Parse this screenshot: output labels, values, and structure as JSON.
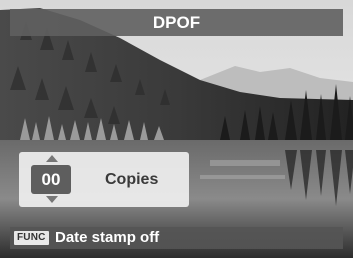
{
  "header": {
    "title": "DPOF"
  },
  "copies_panel": {
    "count": "00",
    "label": "Copies"
  },
  "footer": {
    "func_key": "FUNC",
    "status": "Date stamp off"
  },
  "icons": [
    "arrow-up-icon",
    "arrow-down-icon"
  ],
  "colors": {
    "bar": "#5f5f5f",
    "panel": "#eeeeee",
    "count_box": "#5e5e5e"
  }
}
